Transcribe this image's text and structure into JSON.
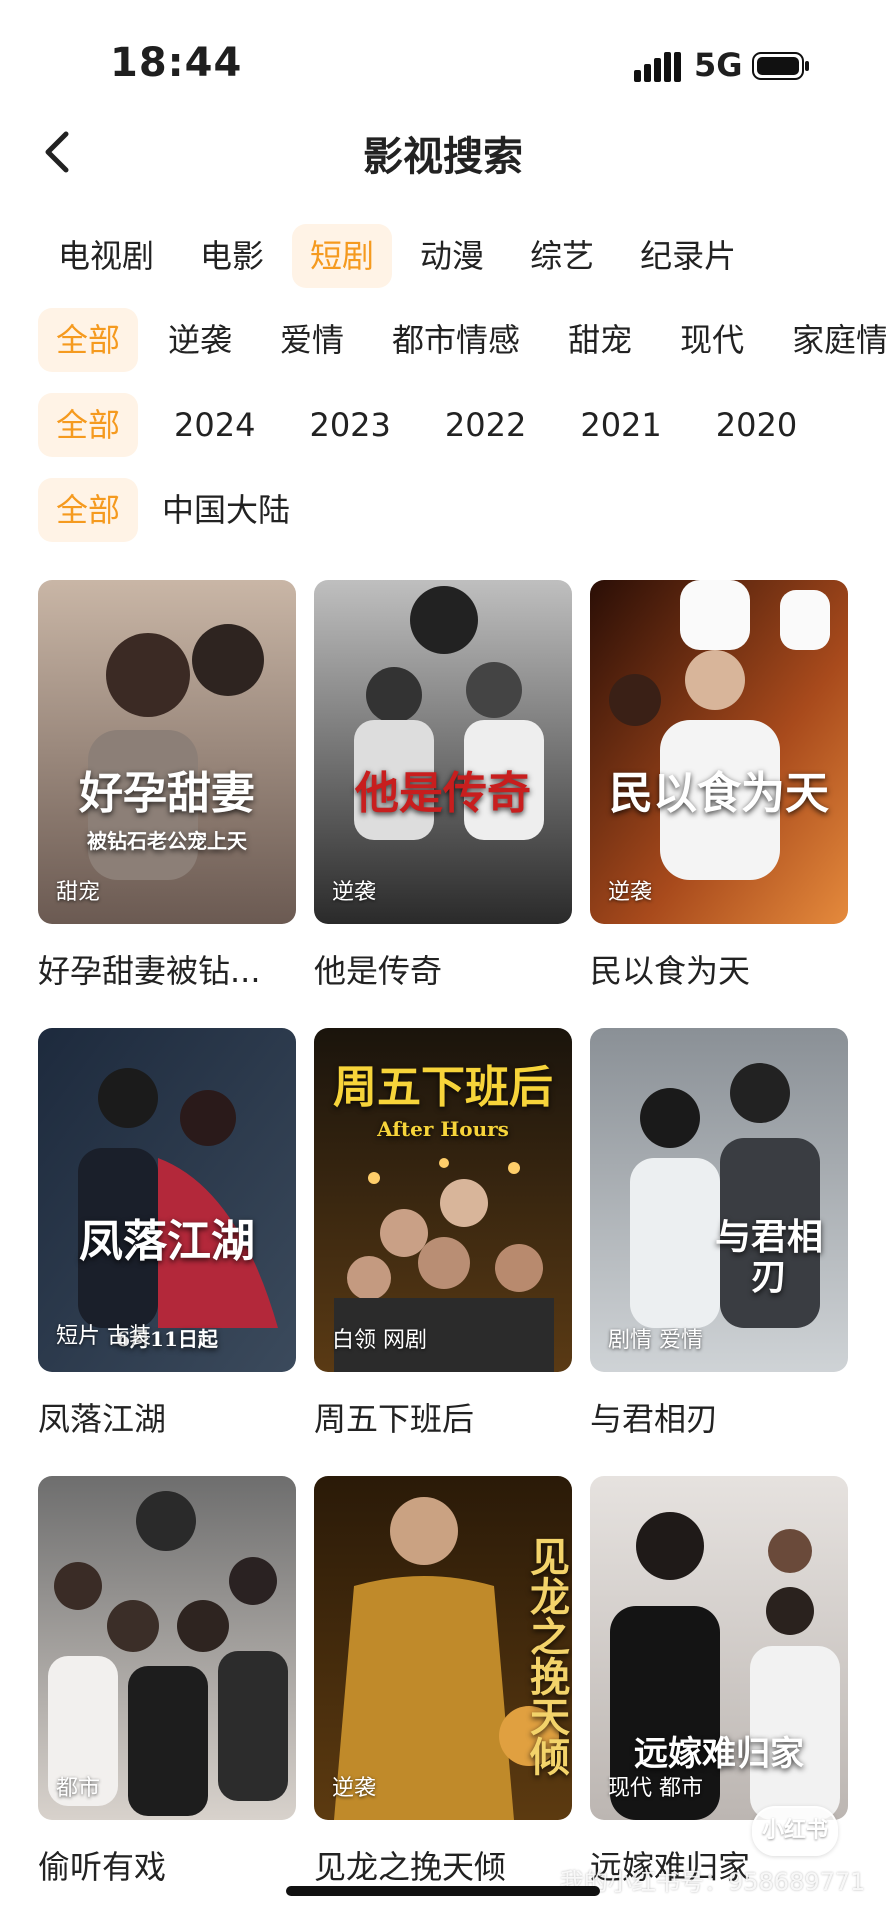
{
  "status_bar": {
    "time": "18:44",
    "network": "5G"
  },
  "header": {
    "title": "影视搜索"
  },
  "categories": [
    {
      "label": "电视剧",
      "active": false
    },
    {
      "label": "电影",
      "active": false
    },
    {
      "label": "短剧",
      "active": true
    },
    {
      "label": "动漫",
      "active": false
    },
    {
      "label": "综艺",
      "active": false
    },
    {
      "label": "纪录片",
      "active": false
    }
  ],
  "genre_filters": [
    "全部",
    "逆袭",
    "爱情",
    "都市情感",
    "甜宠",
    "现代",
    "家庭情感"
  ],
  "year_filters": [
    "全部",
    "2024",
    "2023",
    "2022",
    "2021",
    "2020"
  ],
  "region_filters": [
    "全部",
    "中国大陆"
  ],
  "results": [
    {
      "title": "好孕甜妻被钻...",
      "tags": "甜宠",
      "poster_text": "好孕甜妻",
      "poster_sub": "被钻石老公宠上天",
      "colors": [
        "#6b5a52",
        "#c9b6a6"
      ]
    },
    {
      "title": "他是传奇",
      "tags": "逆袭",
      "poster_text": "他是传奇",
      "poster_sub": "",
      "colors": [
        "#3a3a3a",
        "#bfbfbf"
      ]
    },
    {
      "title": "民以食为天",
      "tags": "逆袭",
      "poster_text": "民以食为天",
      "poster_sub": "",
      "colors": [
        "#6a2b12",
        "#e58a3c"
      ]
    },
    {
      "title": "凤落江湖",
      "tags": "短片 古装",
      "poster_text": "凤落江湖",
      "poster_sub": "6月11日起",
      "colors": [
        "#1d2a3d",
        "#b3283a"
      ]
    },
    {
      "title": "周五下班后",
      "tags": "白领 网剧",
      "poster_text": "周五下班后",
      "poster_sub": "After Hours",
      "colors": [
        "#1a140c",
        "#8a5a1e"
      ]
    },
    {
      "title": "与君相刃",
      "tags": "剧情 爱情",
      "poster_text": "与君相刃",
      "poster_sub": "",
      "colors": [
        "#5a6066",
        "#cfd3d6"
      ]
    },
    {
      "title": "偷听有戏",
      "tags": "都市",
      "poster_text": "",
      "poster_sub": "",
      "colors": [
        "#6e6e6e",
        "#d8d2cc"
      ]
    },
    {
      "title": "见龙之挽天倾",
      "tags": "逆袭",
      "poster_text": "见龙之挽天倾",
      "poster_sub": "",
      "colors": [
        "#2a1a08",
        "#c08a2a"
      ]
    },
    {
      "title": "远嫁难归家",
      "tags": "现代 都市",
      "poster_text": "远嫁难归家",
      "poster_sub": "",
      "colors": [
        "#3a3a44",
        "#e6e2df"
      ]
    }
  ],
  "float_button": "小红书",
  "watermark": "我的小红书号：958689771"
}
